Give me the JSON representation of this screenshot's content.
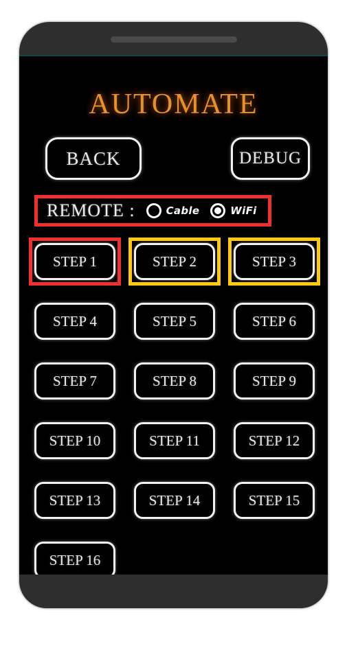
{
  "device": {
    "frame_color": "#2e2e2e",
    "screen_background": "#000000",
    "speaker_name": "speaker-grille",
    "accent_line_color": "#13424a"
  },
  "screen": {
    "title": "AUTOMATE",
    "title_color": "#E8912B"
  },
  "toolbar": {
    "back_label": "BACK",
    "debug_label": "DEBUG"
  },
  "remote": {
    "label": "REMOTE :",
    "highlight_color": "#F03030",
    "options": [
      {
        "label": "Cable",
        "selected": false
      },
      {
        "label": "WiFi",
        "selected": true
      }
    ],
    "selected_value": "WiFi"
  },
  "steps": {
    "highlight_red": "#F03030",
    "highlight_yellow": "#FFC90E",
    "items": [
      {
        "label": "STEP 1",
        "highlight": "red"
      },
      {
        "label": "STEP 2",
        "highlight": "yellow"
      },
      {
        "label": "STEP 3",
        "highlight": "yellow"
      },
      {
        "label": "STEP 4",
        "highlight": "none"
      },
      {
        "label": "STEP 5",
        "highlight": "none"
      },
      {
        "label": "STEP 6",
        "highlight": "none"
      },
      {
        "label": "STEP 7",
        "highlight": "none"
      },
      {
        "label": "STEP 8",
        "highlight": "none"
      },
      {
        "label": "STEP 9",
        "highlight": "none"
      },
      {
        "label": "STEP 10",
        "highlight": "none"
      },
      {
        "label": "STEP 11",
        "highlight": "none"
      },
      {
        "label": "STEP 12",
        "highlight": "none"
      },
      {
        "label": "STEP 13",
        "highlight": "none"
      },
      {
        "label": "STEP 14",
        "highlight": "none"
      },
      {
        "label": "STEP 15",
        "highlight": "none"
      },
      {
        "label": "STEP 16",
        "highlight": "none"
      }
    ]
  }
}
